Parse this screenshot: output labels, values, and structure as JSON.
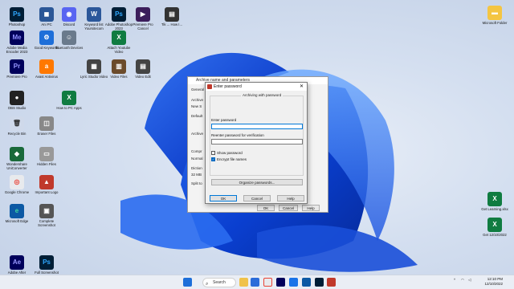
{
  "desktop": {
    "left_icons": [
      {
        "label": "Photoshop",
        "glyph": "Ps",
        "color": "#001e36",
        "fg": "#31a8ff"
      },
      {
        "label": "Ani PC",
        "glyph": "◼",
        "color": "#2b5797",
        "fg": "#fff"
      },
      {
        "label": "Discord",
        "glyph": "◉",
        "color": "#5865f2",
        "fg": "#fff"
      },
      {
        "label": "Keyword list Yoursitecom",
        "glyph": "W",
        "color": "#2b579a",
        "fg": "#fff"
      },
      {
        "label": "Adobe Photoshop 2023",
        "glyph": "Ps",
        "color": "#001e36",
        "fg": "#31a8ff"
      },
      {
        "label": "Premiere Pro Cancel",
        "glyph": "▶",
        "color": "#3b1d5b",
        "fg": "#fff"
      },
      {
        "label": "Tik ... How I...",
        "glyph": "▤",
        "color": "#333",
        "fg": "#fff"
      },
      {
        "label": "Adobe Media Encoder 2023",
        "glyph": "Me",
        "color": "#00005b",
        "fg": "#8f8fff"
      },
      {
        "label": "Good Keywords",
        "glyph": "⚙",
        "color": "#1e6fd9",
        "fg": "#fff"
      },
      {
        "label": "Bluetooth Devices",
        "glyph": "☺",
        "color": "#6a7a8c",
        "fg": "#fff"
      },
      {
        "label": "Attach Youtube Video",
        "glyph": "X",
        "color": "#107c41",
        "fg": "#fff"
      },
      {
        "label": "Premiere Pro",
        "glyph": "Pr",
        "color": "#00005b",
        "fg": "#9999ff"
      },
      {
        "label": "Avast Antivirus",
        "glyph": "a",
        "color": "#ff7800",
        "fg": "#fff"
      },
      {
        "label": "Lyric Studio Video",
        "glyph": "▦",
        "color": "#444",
        "fg": "#fff"
      },
      {
        "label": "Video Files",
        "glyph": "▥",
        "color": "#6b4b2b",
        "fg": "#fff"
      },
      {
        "label": "Video Edit",
        "glyph": "▤",
        "color": "#444",
        "fg": "#fff"
      },
      {
        "label": "OBS Studio",
        "glyph": "●",
        "color": "#222",
        "fg": "#fff"
      },
      {
        "label": "How to PC Apps",
        "glyph": "X",
        "color": "#107c41",
        "fg": "#fff"
      },
      {
        "label": "Recycle Bin",
        "glyph": "🗑",
        "color": "#cfd9ea",
        "fg": "#333"
      },
      {
        "label": "Eraser Files",
        "glyph": "◫",
        "color": "#888",
        "fg": "#fff"
      },
      {
        "label": "Wondershare UniConverter",
        "glyph": "◆",
        "color": "#1a6a3a",
        "fg": "#fff"
      },
      {
        "label": "Hidden Files",
        "glyph": "▭",
        "color": "#999",
        "fg": "#fff"
      },
      {
        "label": "Google Chrome",
        "glyph": "◎",
        "color": "#e8eaed",
        "fg": "#ea4335"
      },
      {
        "label": "Important Logo",
        "glyph": "▲",
        "color": "#c0392b",
        "fg": "#fff"
      },
      {
        "label": "Microsoft Edge",
        "glyph": "e",
        "color": "#0c59a4",
        "fg": "#3fd7a0"
      },
      {
        "label": "Complete Screenshot",
        "glyph": "▣",
        "color": "#555",
        "fg": "#fff"
      },
      {
        "label": "Adobe After Effects 2023",
        "glyph": "Ae",
        "color": "#00005b",
        "fg": "#9999ff"
      },
      {
        "label": "Full Screenshot",
        "glyph": "Ps",
        "color": "#001e36",
        "fg": "#31a8ff"
      }
    ],
    "right_icons": [
      {
        "label": "Microsoft Folder",
        "glyph": "▬",
        "color": "#f4c542",
        "fg": "#fff"
      },
      {
        "label": "Get Learning.xlsx",
        "glyph": "X",
        "color": "#107c41",
        "fg": "#fff"
      },
      {
        "label": "Get 12/10/2022",
        "glyph": "X",
        "color": "#107c41",
        "fg": "#fff"
      }
    ]
  },
  "bg_window": {
    "title": "Archive name and parameters",
    "labels": [
      "General",
      "Archive",
      "New S",
      "Default",
      "Archive",
      "Compr",
      "Normal",
      "Diction",
      "32 MB",
      "Split to"
    ],
    "ok": "OK",
    "cancel": "Cancel",
    "help": "Help"
  },
  "dialog": {
    "title": "Enter password",
    "group_title": "Archiving with password",
    "enter_label": "Enter password",
    "reenter_label": "Reenter password for verification",
    "show_password": "Show password",
    "show_password_checked": false,
    "encrypt_names": "Encrypt file names",
    "encrypt_names_checked": true,
    "organize_button": "Organize passwords...",
    "ok": "OK",
    "cancel": "Cancel",
    "help": "Help"
  },
  "taskbar": {
    "search_label": "Search",
    "clock_time": "12:10 PM",
    "clock_date": "12/10/2022",
    "lang": "ENG"
  }
}
